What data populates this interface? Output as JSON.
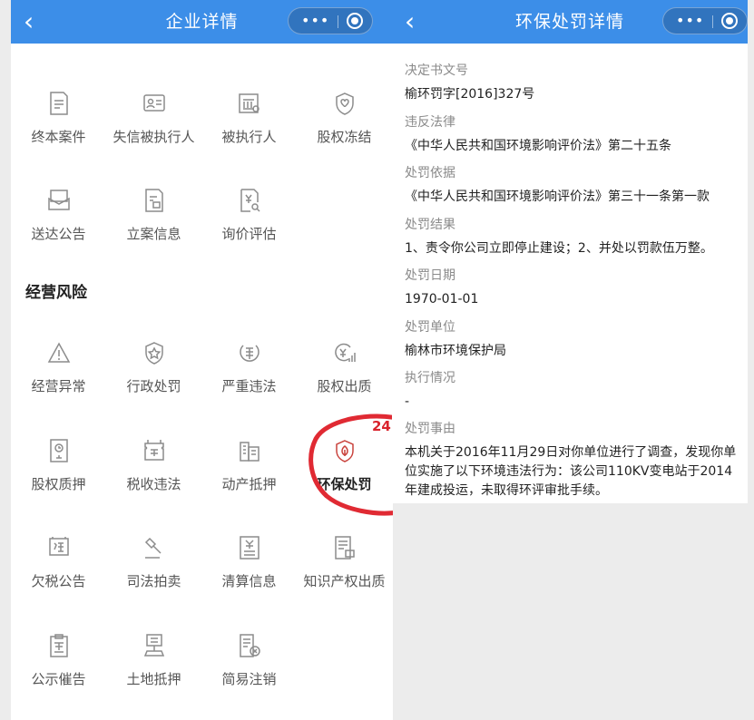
{
  "left": {
    "title": "企业详情",
    "back": "‹",
    "dots": "•••",
    "risk_items": [
      {
        "label": "终本案件",
        "icon": "document-list-icon"
      },
      {
        "label": "失信被执行人",
        "icon": "id-card-icon"
      },
      {
        "label": "被执行人",
        "icon": "court-search-icon"
      },
      {
        "label": "股权冻结",
        "icon": "frozen-heart-shield-icon"
      },
      {
        "label": "送达公告",
        "icon": "envelope-icon"
      },
      {
        "label": "立案信息",
        "icon": "case-file-icon"
      },
      {
        "label": "询价评估",
        "icon": "price-search-icon"
      }
    ],
    "section_title": "经营风险",
    "biz_items": [
      {
        "label": "经营异常",
        "icon": "warning-triangle-icon"
      },
      {
        "label": "行政处罚",
        "icon": "star-shield-icon"
      },
      {
        "label": "严重违法",
        "icon": "illegal-stamp-icon"
      },
      {
        "label": "股权出质",
        "icon": "money-chart-icon"
      },
      {
        "label": "股权质押",
        "icon": "pledge-document-icon"
      },
      {
        "label": "税收违法",
        "icon": "tax-ticket-icon"
      },
      {
        "label": "动产抵押",
        "icon": "building-icon"
      },
      {
        "label": "环保处罚",
        "icon": "leaf-shield-icon"
      },
      {
        "label": "欠税公告",
        "icon": "tax-notice-icon"
      },
      {
        "label": "司法拍卖",
        "icon": "gavel-icon"
      },
      {
        "label": "清算信息",
        "icon": "yuan-document-icon"
      },
      {
        "label": "知识产权出质",
        "icon": "ip-document-icon"
      },
      {
        "label": "公示催告",
        "icon": "clipboard-icon"
      },
      {
        "label": "土地抵押",
        "icon": "land-sign-icon"
      },
      {
        "label": "简易注销",
        "icon": "cancel-document-icon"
      }
    ],
    "annotation_number": "24"
  },
  "right": {
    "title": "环保处罚详情",
    "back": "‹",
    "dots": "•••",
    "fields": [
      {
        "label": "决定书文号",
        "value": "榆环罚字[2016]327号"
      },
      {
        "label": "违反法律",
        "value": "《中华人民共和国环境影响评价法》第二十五条"
      },
      {
        "label": "处罚依据",
        "value": "《中华人民共和国环境影响评价法》第三十一条第一款"
      },
      {
        "label": "处罚结果",
        "value": "1、责令你公司立即停止建设；2、并处以罚款伍万整。"
      },
      {
        "label": "处罚日期",
        "value": "1970-01-01"
      },
      {
        "label": "处罚单位",
        "value": "榆林市环境保护局"
      },
      {
        "label": "执行情况",
        "value": "-"
      },
      {
        "label": "处罚事由",
        "value": "本机关于2016年11月29日对你单位进行了调查，发现你单位实施了以下环境违法行为：该公司110KV变电站于2014年建成投运，未取得环评审批手续。"
      }
    ]
  },
  "colors": {
    "navbar": "#3c8ee8",
    "icon": "#8c8c8c",
    "annotation": "#d9232c"
  }
}
